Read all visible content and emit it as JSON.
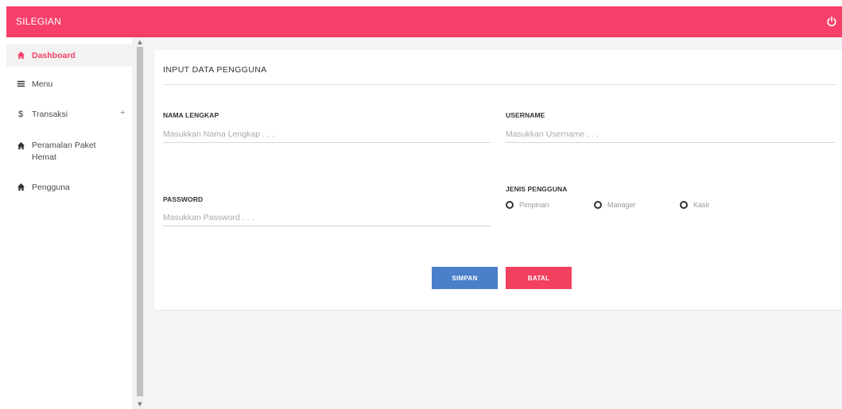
{
  "app": {
    "brand": "SILEGIAN"
  },
  "sidebar": {
    "items": [
      {
        "label": "Dashboard",
        "icon": "home-icon",
        "active": true
      },
      {
        "label": "Menu",
        "icon": "menu-icon"
      },
      {
        "label": "Transaksi",
        "icon": "dollar-icon",
        "expand": "+"
      },
      {
        "label": "Peramalan Paket",
        "label2": "Hemat",
        "icon": "home-icon"
      },
      {
        "label": "Pengguna",
        "icon": "home-icon"
      }
    ]
  },
  "form": {
    "title": "INPUT DATA PENGGUNA",
    "nama_label": "NAMA LENGKAP",
    "nama_placeholder": "Masukkan Nama Lengkap . . .",
    "username_label": "USERNAME",
    "username_placeholder": "Masukkan Username . . .",
    "password_label": "PASSWORD",
    "password_placeholder": "Masukkan Password . . .",
    "jenis_label": "JENIS PENGGUNA",
    "jenis_options": [
      "Pimpinan",
      "Manager",
      "Kasir"
    ],
    "save_label": "SIMPAN",
    "cancel_label": "BATAL"
  },
  "colors": {
    "accent": "#f6406a",
    "save": "#4a7fca",
    "cancel": "#f2405f"
  }
}
